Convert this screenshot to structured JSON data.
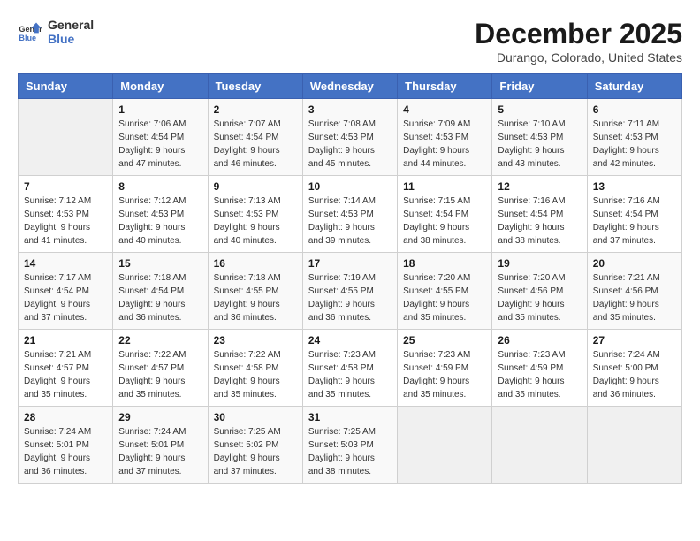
{
  "logo": {
    "line1": "General",
    "line2": "Blue"
  },
  "title": "December 2025",
  "location": "Durango, Colorado, United States",
  "days_of_week": [
    "Sunday",
    "Monday",
    "Tuesday",
    "Wednesday",
    "Thursday",
    "Friday",
    "Saturday"
  ],
  "weeks": [
    [
      {
        "day": "",
        "sunrise": "",
        "sunset": "",
        "daylight": ""
      },
      {
        "day": "1",
        "sunrise": "Sunrise: 7:06 AM",
        "sunset": "Sunset: 4:54 PM",
        "daylight": "Daylight: 9 hours and 47 minutes."
      },
      {
        "day": "2",
        "sunrise": "Sunrise: 7:07 AM",
        "sunset": "Sunset: 4:54 PM",
        "daylight": "Daylight: 9 hours and 46 minutes."
      },
      {
        "day": "3",
        "sunrise": "Sunrise: 7:08 AM",
        "sunset": "Sunset: 4:53 PM",
        "daylight": "Daylight: 9 hours and 45 minutes."
      },
      {
        "day": "4",
        "sunrise": "Sunrise: 7:09 AM",
        "sunset": "Sunset: 4:53 PM",
        "daylight": "Daylight: 9 hours and 44 minutes."
      },
      {
        "day": "5",
        "sunrise": "Sunrise: 7:10 AM",
        "sunset": "Sunset: 4:53 PM",
        "daylight": "Daylight: 9 hours and 43 minutes."
      },
      {
        "day": "6",
        "sunrise": "Sunrise: 7:11 AM",
        "sunset": "Sunset: 4:53 PM",
        "daylight": "Daylight: 9 hours and 42 minutes."
      }
    ],
    [
      {
        "day": "7",
        "sunrise": "Sunrise: 7:12 AM",
        "sunset": "Sunset: 4:53 PM",
        "daylight": "Daylight: 9 hours and 41 minutes."
      },
      {
        "day": "8",
        "sunrise": "Sunrise: 7:12 AM",
        "sunset": "Sunset: 4:53 PM",
        "daylight": "Daylight: 9 hours and 40 minutes."
      },
      {
        "day": "9",
        "sunrise": "Sunrise: 7:13 AM",
        "sunset": "Sunset: 4:53 PM",
        "daylight": "Daylight: 9 hours and 40 minutes."
      },
      {
        "day": "10",
        "sunrise": "Sunrise: 7:14 AM",
        "sunset": "Sunset: 4:53 PM",
        "daylight": "Daylight: 9 hours and 39 minutes."
      },
      {
        "day": "11",
        "sunrise": "Sunrise: 7:15 AM",
        "sunset": "Sunset: 4:54 PM",
        "daylight": "Daylight: 9 hours and 38 minutes."
      },
      {
        "day": "12",
        "sunrise": "Sunrise: 7:16 AM",
        "sunset": "Sunset: 4:54 PM",
        "daylight": "Daylight: 9 hours and 38 minutes."
      },
      {
        "day": "13",
        "sunrise": "Sunrise: 7:16 AM",
        "sunset": "Sunset: 4:54 PM",
        "daylight": "Daylight: 9 hours and 37 minutes."
      }
    ],
    [
      {
        "day": "14",
        "sunrise": "Sunrise: 7:17 AM",
        "sunset": "Sunset: 4:54 PM",
        "daylight": "Daylight: 9 hours and 37 minutes."
      },
      {
        "day": "15",
        "sunrise": "Sunrise: 7:18 AM",
        "sunset": "Sunset: 4:54 PM",
        "daylight": "Daylight: 9 hours and 36 minutes."
      },
      {
        "day": "16",
        "sunrise": "Sunrise: 7:18 AM",
        "sunset": "Sunset: 4:55 PM",
        "daylight": "Daylight: 9 hours and 36 minutes."
      },
      {
        "day": "17",
        "sunrise": "Sunrise: 7:19 AM",
        "sunset": "Sunset: 4:55 PM",
        "daylight": "Daylight: 9 hours and 36 minutes."
      },
      {
        "day": "18",
        "sunrise": "Sunrise: 7:20 AM",
        "sunset": "Sunset: 4:55 PM",
        "daylight": "Daylight: 9 hours and 35 minutes."
      },
      {
        "day": "19",
        "sunrise": "Sunrise: 7:20 AM",
        "sunset": "Sunset: 4:56 PM",
        "daylight": "Daylight: 9 hours and 35 minutes."
      },
      {
        "day": "20",
        "sunrise": "Sunrise: 7:21 AM",
        "sunset": "Sunset: 4:56 PM",
        "daylight": "Daylight: 9 hours and 35 minutes."
      }
    ],
    [
      {
        "day": "21",
        "sunrise": "Sunrise: 7:21 AM",
        "sunset": "Sunset: 4:57 PM",
        "daylight": "Daylight: 9 hours and 35 minutes."
      },
      {
        "day": "22",
        "sunrise": "Sunrise: 7:22 AM",
        "sunset": "Sunset: 4:57 PM",
        "daylight": "Daylight: 9 hours and 35 minutes."
      },
      {
        "day": "23",
        "sunrise": "Sunrise: 7:22 AM",
        "sunset": "Sunset: 4:58 PM",
        "daylight": "Daylight: 9 hours and 35 minutes."
      },
      {
        "day": "24",
        "sunrise": "Sunrise: 7:23 AM",
        "sunset": "Sunset: 4:58 PM",
        "daylight": "Daylight: 9 hours and 35 minutes."
      },
      {
        "day": "25",
        "sunrise": "Sunrise: 7:23 AM",
        "sunset": "Sunset: 4:59 PM",
        "daylight": "Daylight: 9 hours and 35 minutes."
      },
      {
        "day": "26",
        "sunrise": "Sunrise: 7:23 AM",
        "sunset": "Sunset: 4:59 PM",
        "daylight": "Daylight: 9 hours and 35 minutes."
      },
      {
        "day": "27",
        "sunrise": "Sunrise: 7:24 AM",
        "sunset": "Sunset: 5:00 PM",
        "daylight": "Daylight: 9 hours and 36 minutes."
      }
    ],
    [
      {
        "day": "28",
        "sunrise": "Sunrise: 7:24 AM",
        "sunset": "Sunset: 5:01 PM",
        "daylight": "Daylight: 9 hours and 36 minutes."
      },
      {
        "day": "29",
        "sunrise": "Sunrise: 7:24 AM",
        "sunset": "Sunset: 5:01 PM",
        "daylight": "Daylight: 9 hours and 37 minutes."
      },
      {
        "day": "30",
        "sunrise": "Sunrise: 7:25 AM",
        "sunset": "Sunset: 5:02 PM",
        "daylight": "Daylight: 9 hours and 37 minutes."
      },
      {
        "day": "31",
        "sunrise": "Sunrise: 7:25 AM",
        "sunset": "Sunset: 5:03 PM",
        "daylight": "Daylight: 9 hours and 38 minutes."
      },
      {
        "day": "",
        "sunrise": "",
        "sunset": "",
        "daylight": ""
      },
      {
        "day": "",
        "sunrise": "",
        "sunset": "",
        "daylight": ""
      },
      {
        "day": "",
        "sunrise": "",
        "sunset": "",
        "daylight": ""
      }
    ]
  ]
}
